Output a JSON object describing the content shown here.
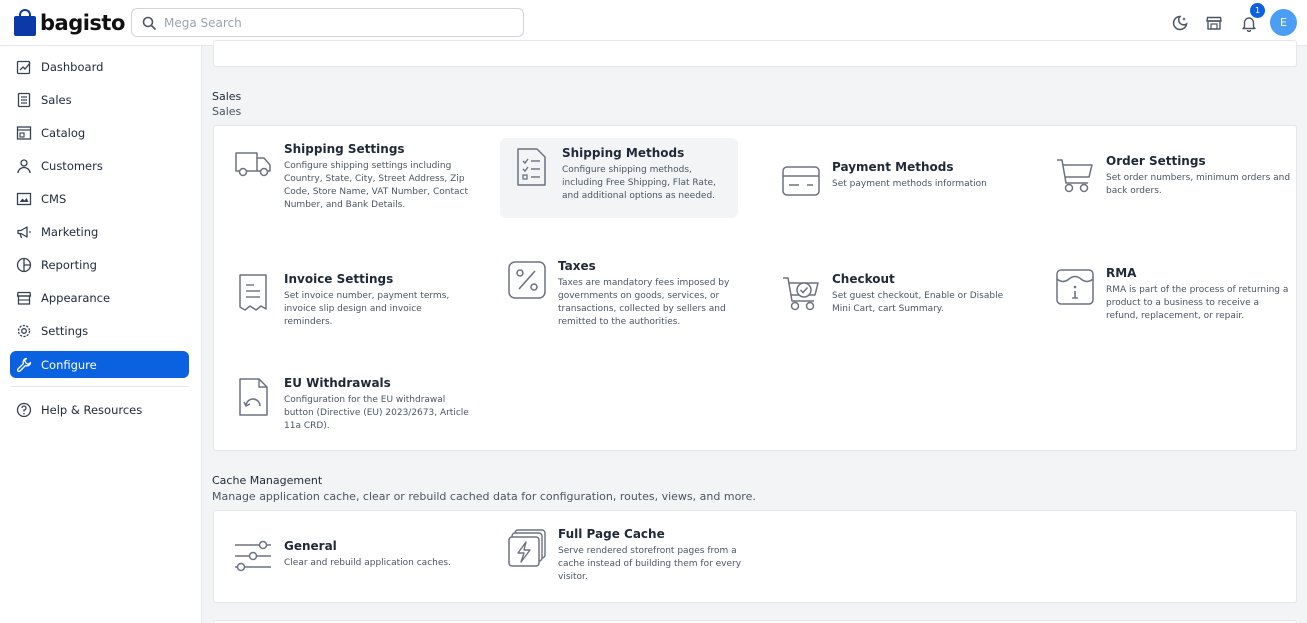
{
  "header": {
    "logo_text": "bagisto",
    "search_placeholder": "Mega Search",
    "notification_count": "1",
    "avatar_initial": "E"
  },
  "sidebar": {
    "items": [
      {
        "label": "Dashboard",
        "icon": "dashboard-icon"
      },
      {
        "label": "Sales",
        "icon": "sales-icon"
      },
      {
        "label": "Catalog",
        "icon": "catalog-icon"
      },
      {
        "label": "Customers",
        "icon": "customers-icon"
      },
      {
        "label": "CMS",
        "icon": "cms-icon"
      },
      {
        "label": "Marketing",
        "icon": "marketing-icon"
      },
      {
        "label": "Reporting",
        "icon": "reporting-icon"
      },
      {
        "label": "Appearance",
        "icon": "appearance-icon"
      },
      {
        "label": "Settings",
        "icon": "settings-icon"
      },
      {
        "label": "Configure",
        "icon": "configure-icon",
        "active": true
      },
      {
        "label": "Help & Resources",
        "icon": "help-icon"
      }
    ]
  },
  "sales_section": {
    "title": "Sales",
    "subtitle": "Sales",
    "tiles": [
      {
        "title": "Shipping Settings",
        "desc": "Configure shipping settings including Country, State, City, Street Address, Zip Code, Store Name, VAT Number, Contact Number, and Bank Details."
      },
      {
        "title": "Shipping Methods",
        "desc": "Configure shipping methods, including Free Shipping, Flat Rate, and additional options as needed."
      },
      {
        "title": "Payment Methods",
        "desc": "Set payment methods information"
      },
      {
        "title": "Order Settings",
        "desc": "Set order numbers, minimum orders and back orders."
      },
      {
        "title": "Invoice Settings",
        "desc": "Set invoice number, payment terms, invoice slip design and invoice reminders."
      },
      {
        "title": "Taxes",
        "desc": "Taxes are mandatory fees imposed by governments on goods, services, or transactions, collected by sellers and remitted to the authorities."
      },
      {
        "title": "Checkout",
        "desc": "Set guest checkout, Enable or Disable Mini Cart, cart Summary."
      },
      {
        "title": "RMA",
        "desc": "RMA is part of the process of returning a product to a business to receive a refund, replacement, or repair."
      },
      {
        "title": "EU Withdrawals",
        "desc": "Configuration for the EU withdrawal button (Directive (EU) 2023/2673, Article 11a CRD)."
      }
    ]
  },
  "cache_section": {
    "title": "Cache Management",
    "subtitle": "Manage application cache, clear or rebuild cached data for configuration, routes, views, and more.",
    "tiles": [
      {
        "title": "General",
        "desc": "Clear and rebuild application caches."
      },
      {
        "title": "Full Page Cache",
        "desc": "Serve rendered storefront pages from a cache instead of building them for every visitor."
      }
    ]
  },
  "colors": {
    "accent": "#0b62e0",
    "brand": "#0b3aa8",
    "avatar": "#4a9ff5"
  }
}
